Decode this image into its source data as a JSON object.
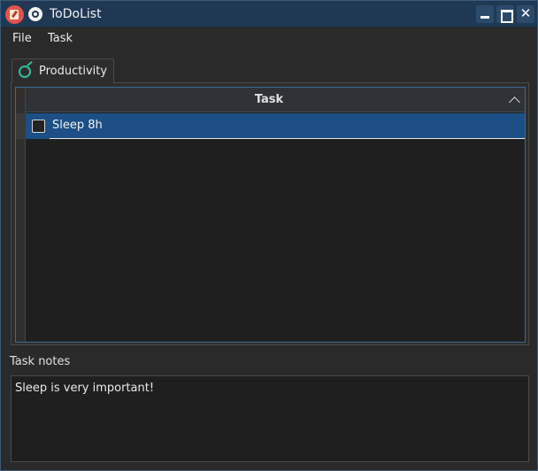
{
  "window": {
    "title": "ToDoList",
    "icons": {
      "app": "todo-app-icon",
      "pin": "pin-icon"
    },
    "controls": {
      "minimize": "minimize-icon",
      "maximize": "maximize-icon",
      "close": "✕"
    }
  },
  "menu": {
    "items": [
      "File",
      "Task"
    ]
  },
  "tabs": [
    {
      "label": "Productivity",
      "icon": "stopwatch-icon",
      "active": true
    }
  ],
  "task_list": {
    "header": "Task",
    "sort": "ascending",
    "rows": [
      {
        "label": "Sleep 8h",
        "checked": false,
        "selected": true
      }
    ]
  },
  "notes": {
    "label": "Task notes",
    "value": "Sleep is very important!"
  },
  "colors": {
    "titlebar": "#1f3954",
    "selection": "#1c4f86",
    "accent": "#2bbf9a",
    "app_icon": "#e2534b"
  }
}
